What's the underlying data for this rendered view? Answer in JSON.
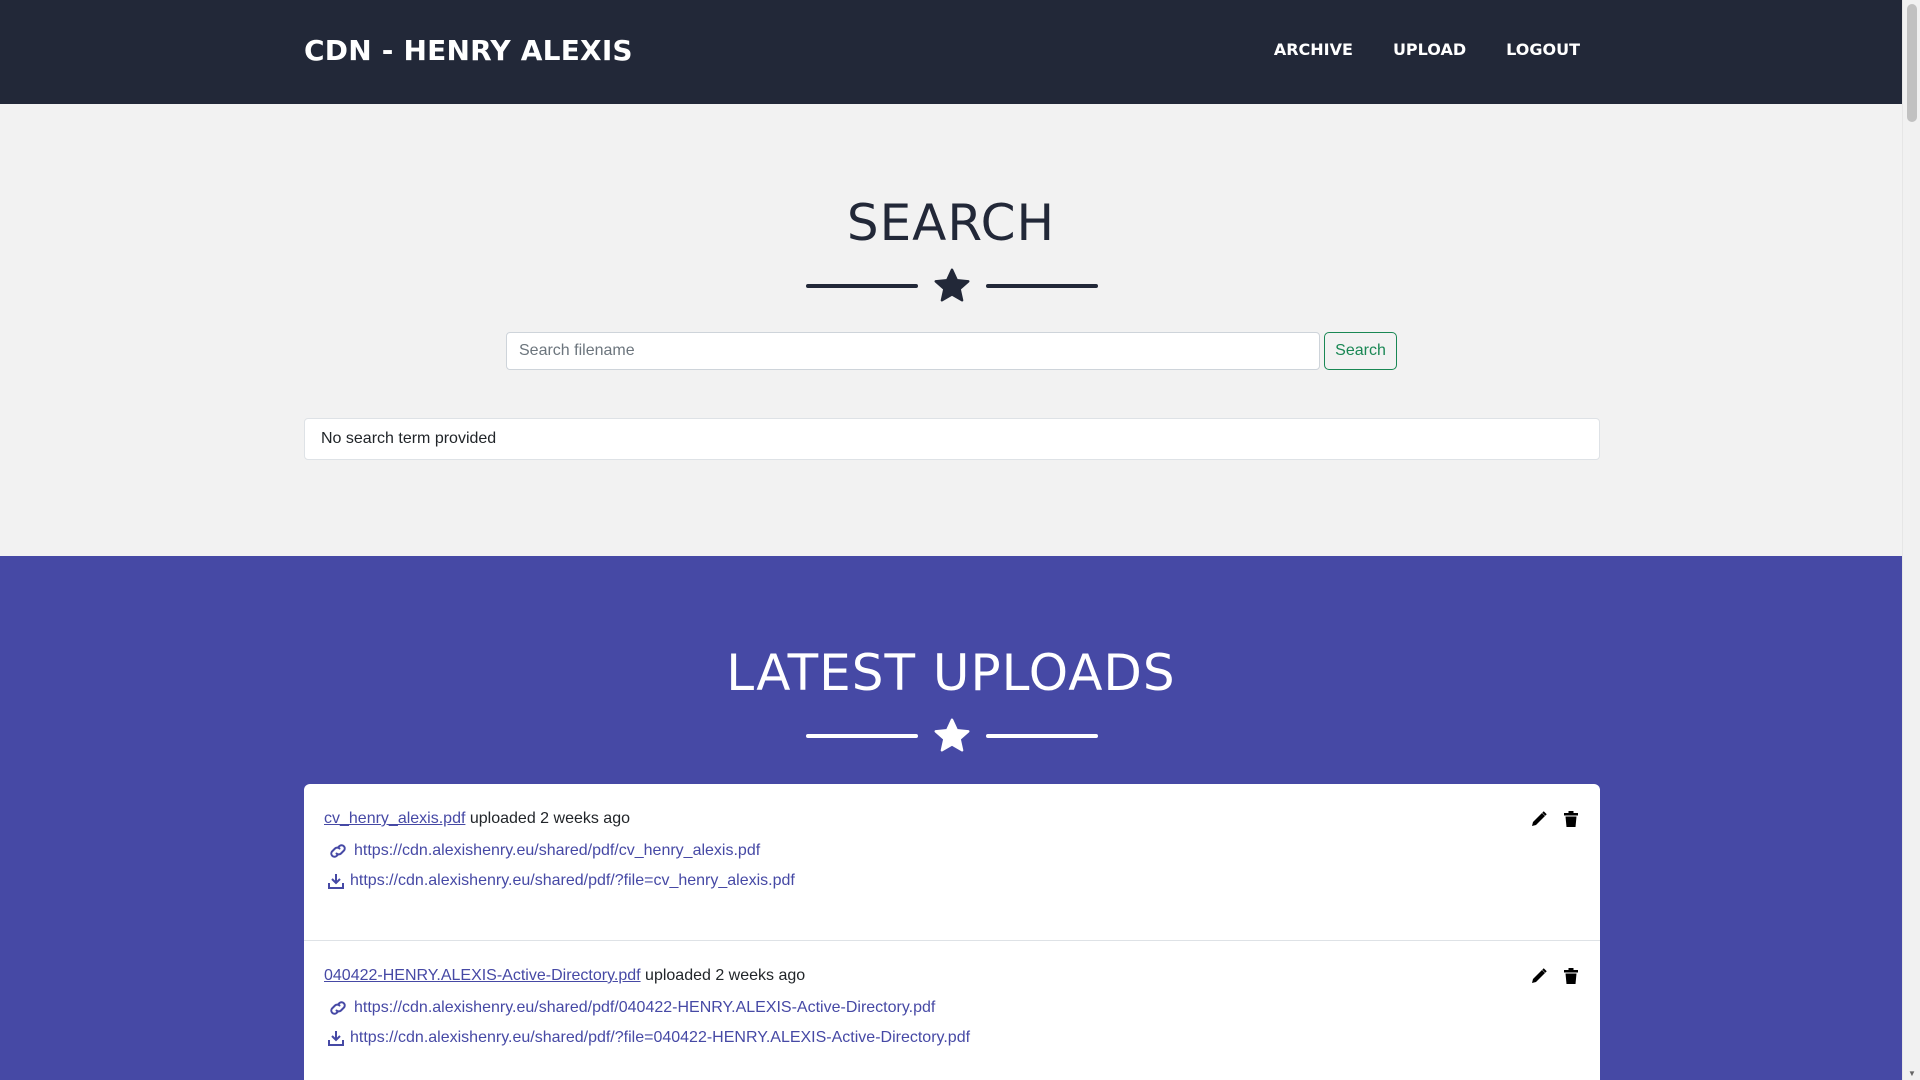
{
  "navbar": {
    "brand": "CDN - HENRY ALEXIS",
    "links": [
      "ARCHIVE",
      "UPLOAD",
      "LOGOUT"
    ]
  },
  "search": {
    "title": "SEARCH",
    "placeholder": "Search filename",
    "button_label": "Search",
    "result_text": "No search term provided"
  },
  "uploads": {
    "title": "LATEST UPLOADS",
    "items": [
      {
        "filename": "cv_henry_alexis.pdf",
        "uploaded_text": "uploaded 2 weeks ago",
        "share_url": "https://cdn.alexishenry.eu/shared/pdf/cv_henry_alexis.pdf",
        "download_url": "https://cdn.alexishenry.eu/shared/pdf/?file=cv_henry_alexis.pdf"
      },
      {
        "filename": "040422-HENRY.ALEXIS-Active-Directory.pdf",
        "uploaded_text": "uploaded 2 weeks ago",
        "share_url": "https://cdn.alexishenry.eu/shared/pdf/040422-HENRY.ALEXIS-Active-Directory.pdf",
        "download_url": "https://cdn.alexishenry.eu/shared/pdf/?file=040422-HENRY.ALEXIS-Active-Directory.pdf"
      }
    ]
  },
  "colors": {
    "navbar_bg": "#222838",
    "uploads_bg": "#4649a5",
    "link": "#4649a5",
    "search_button": "#198754"
  }
}
